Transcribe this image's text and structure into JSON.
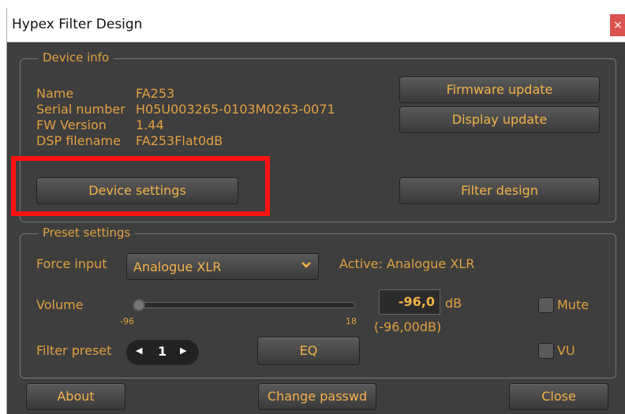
{
  "window": {
    "title": "Hypex Filter Design",
    "close_symbol": "×"
  },
  "device_info": {
    "legend": "Device info",
    "name_label": "Name",
    "name_value": "FA253",
    "serial_label": "Serial number",
    "serial_value": "H05U003265-0103M0263-0071",
    "fw_label": "FW Version",
    "fw_value": "1.44",
    "dsp_label": "DSP filename",
    "dsp_value": "FA253Flat0dB",
    "firmware_update": "Firmware update",
    "display_update": "Display update",
    "device_settings": "Device settings",
    "filter_design": "Filter design"
  },
  "preset": {
    "legend": "Preset settings",
    "force_input_label": "Force input",
    "force_input_value": "Analogue XLR",
    "active_text": "Active: Analogue XLR",
    "volume_label": "Volume",
    "volume_min": "-96",
    "volume_max": "18",
    "volume_value": "-96,0",
    "volume_unit": "dB",
    "volume_detail": "(-96,00dB)",
    "volume_level": 0,
    "mute_label": "Mute",
    "filter_preset_label": "Filter preset",
    "filter_preset_value": "1",
    "prev_symbol": "◀",
    "next_symbol": "▶",
    "eq_button": "EQ",
    "vu_label": "VU"
  },
  "footer": {
    "about": "About",
    "change_passwd": "Change passwd",
    "close": "Close"
  },
  "colors": {
    "accent": "#f2b24a",
    "background": "#3e3e3e",
    "highlight": "#ff1212"
  }
}
